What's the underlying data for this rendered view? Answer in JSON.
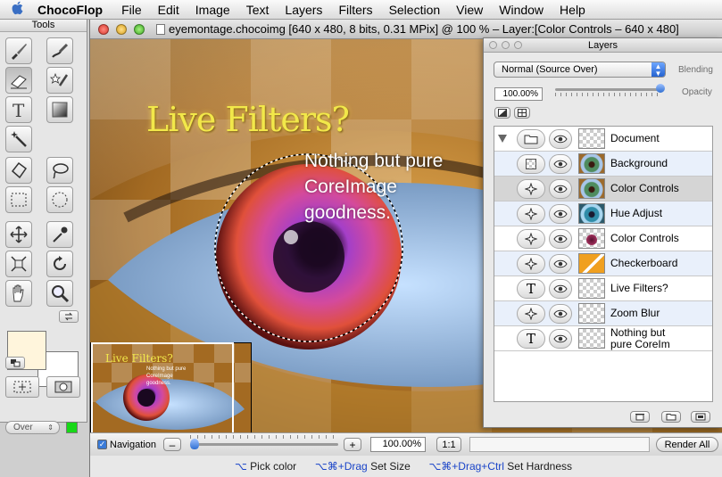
{
  "menubar": {
    "apple": "",
    "app_name": "ChocoFlop",
    "items": [
      "File",
      "Edit",
      "Image",
      "Text",
      "Layers",
      "Filters",
      "Selection",
      "View",
      "Window",
      "Help"
    ]
  },
  "tools": {
    "title": "Tools",
    "icons": [
      "brush-icon",
      "smudge-icon",
      "eraser-icon",
      "sparkle-brush-icon",
      "text-tool-icon",
      "gradient-icon",
      "magic-wand-icon",
      "lasso-polygon-icon",
      "lasso-icon",
      "rect-select-icon",
      "ellipse-select-icon",
      "move-icon",
      "eyedropper-icon",
      "transform-icon",
      "rotate-icon",
      "hand-icon",
      "zoom-icon"
    ],
    "foreground_color": "#fff5dc",
    "background_color": "#ffffff",
    "blend_mode": "Over",
    "status_color": "#18d818"
  },
  "document": {
    "title": "eyemontage.chocoimg [640 x 480, 8 bits, 0.31 MPix] @ 100 % – Layer:[Color Controls – 640 x 480]",
    "canvas_title": "Live Filters?",
    "caption": [
      "Nothing but pure",
      "CoreImage",
      "goodness."
    ],
    "navigation_label": "Navigation",
    "navigation_checked": true,
    "zoom_minus": "–",
    "zoom_plus": "+",
    "zoom_value": "100.00%",
    "one_to_one": "1:1",
    "render_all": "Render All",
    "hints": [
      {
        "key": "⌥",
        "text": " Pick color"
      },
      {
        "key": "⌥⌘+Drag",
        "text": " Set Size"
      },
      {
        "key": "⌥⌘+Drag+Ctrl",
        "text": " Set Hardness"
      }
    ]
  },
  "layers": {
    "title": "Layers",
    "blend_mode": "Normal (Source Over)",
    "blend_label": "Blending",
    "opacity_value": "100.00%",
    "opacity_fraction": 1.0,
    "opacity_label": "Opacity",
    "rows": [
      {
        "name": "Document",
        "type": "folder-icon",
        "thumb": "checker",
        "style": "",
        "expand": true
      },
      {
        "name": "Background",
        "type": "checker-layer-icon",
        "thumb": "eye",
        "style": "alt"
      },
      {
        "name": "Color Controls",
        "type": "filter-icon",
        "thumb": "eye",
        "style": "sel"
      },
      {
        "name": "Hue Adjust",
        "type": "filter-icon",
        "thumb": "eye-blue",
        "style": "alt"
      },
      {
        "name": "Color Controls",
        "type": "filter-icon",
        "thumb": "drop",
        "style": ""
      },
      {
        "name": "Checkerboard",
        "type": "filter-icon",
        "thumb": "orange",
        "style": "alt"
      },
      {
        "name": "Live Filters?",
        "type": "text-icon",
        "thumb": "checker",
        "style": ""
      },
      {
        "name": "Zoom Blur",
        "type": "filter-icon",
        "thumb": "checker",
        "style": "alt"
      },
      {
        "name": "Nothing but\npure CoreIm",
        "type": "text-icon",
        "thumb": "checker",
        "style": ""
      }
    ]
  },
  "colors": {
    "accent": "#2f6fd2",
    "title_yellow": "#f2e84a",
    "close_red": "#e6544c",
    "minimize_yellow": "#e8b530",
    "zoom_green": "#5cbf3a"
  }
}
